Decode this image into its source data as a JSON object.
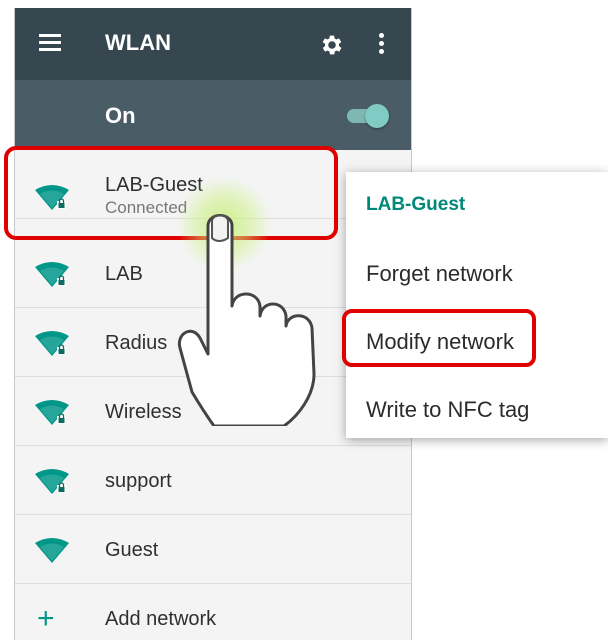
{
  "toolbar": {
    "title": "WLAN",
    "menu_icon": "menu-icon",
    "settings_icon": "gear-icon",
    "overflow_icon": "overflow-menu-icon"
  },
  "switch": {
    "label": "On",
    "state": "on",
    "accent": "#80cbc4"
  },
  "networks": [
    {
      "name": "LAB-Guest",
      "status": "Connected",
      "secured": true
    },
    {
      "name": "LAB",
      "secured": true
    },
    {
      "name": "Radius",
      "secured": true
    },
    {
      "name": "Wireless",
      "secured": true
    },
    {
      "name": "support",
      "secured": true
    },
    {
      "name": "Guest",
      "secured": false
    }
  ],
  "add_network": {
    "label": "Add network",
    "icon": "plus-icon"
  },
  "popup": {
    "title": "LAB-Guest",
    "items": [
      "Forget network",
      "Modify network",
      "Write to NFC tag"
    ]
  },
  "colors": {
    "toolbar": "#36474f",
    "switch_bar": "#4a5c66",
    "accent": "#009688",
    "highlight": "#e00000"
  }
}
